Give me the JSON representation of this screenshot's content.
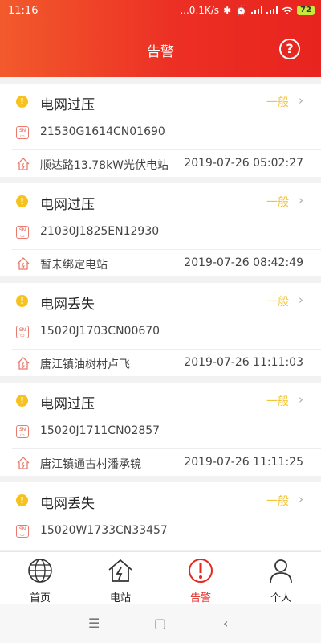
{
  "status": {
    "time": "11:16",
    "speed": "...0.1K/s",
    "battery": "72"
  },
  "header": {
    "title": "告警",
    "help_glyph": "?"
  },
  "alarms": [
    {
      "type": "电网过压",
      "level": "一般",
      "serial": "21530G1614CN01690",
      "station": "顺达路13.78kW光伏电站",
      "time": "2019-07-26 05:02:27"
    },
    {
      "type": "电网过压",
      "level": "一般",
      "serial": "21030J1825EN12930",
      "station": "暂未绑定电站",
      "time": "2019-07-26 08:42:49"
    },
    {
      "type": "电网丢失",
      "level": "一般",
      "serial": "15020J1703CN00670",
      "station": "唐江镇油树村卢飞",
      "time": "2019-07-26 11:11:03"
    },
    {
      "type": "电网过压",
      "level": "一般",
      "serial": "15020J1711CN02857",
      "station": "唐江镇通古村潘承镜",
      "time": "2019-07-26 11:11:25"
    },
    {
      "type": "电网丢失",
      "level": "一般",
      "serial": "15020W1733CN33457",
      "station": "",
      "time": ""
    }
  ],
  "tabs": [
    {
      "label": "首页",
      "icon": "globe-icon"
    },
    {
      "label": "电站",
      "icon": "house-lightning-icon"
    },
    {
      "label": "告警",
      "icon": "alert-circle-icon",
      "active": true
    },
    {
      "label": "个人",
      "icon": "person-icon"
    }
  ],
  "colors": {
    "header_start": "#f25a2c",
    "header_end": "#e8241e",
    "warning": "#f6c21e",
    "level": "#f2c43a",
    "active_tab": "#e2281f"
  }
}
